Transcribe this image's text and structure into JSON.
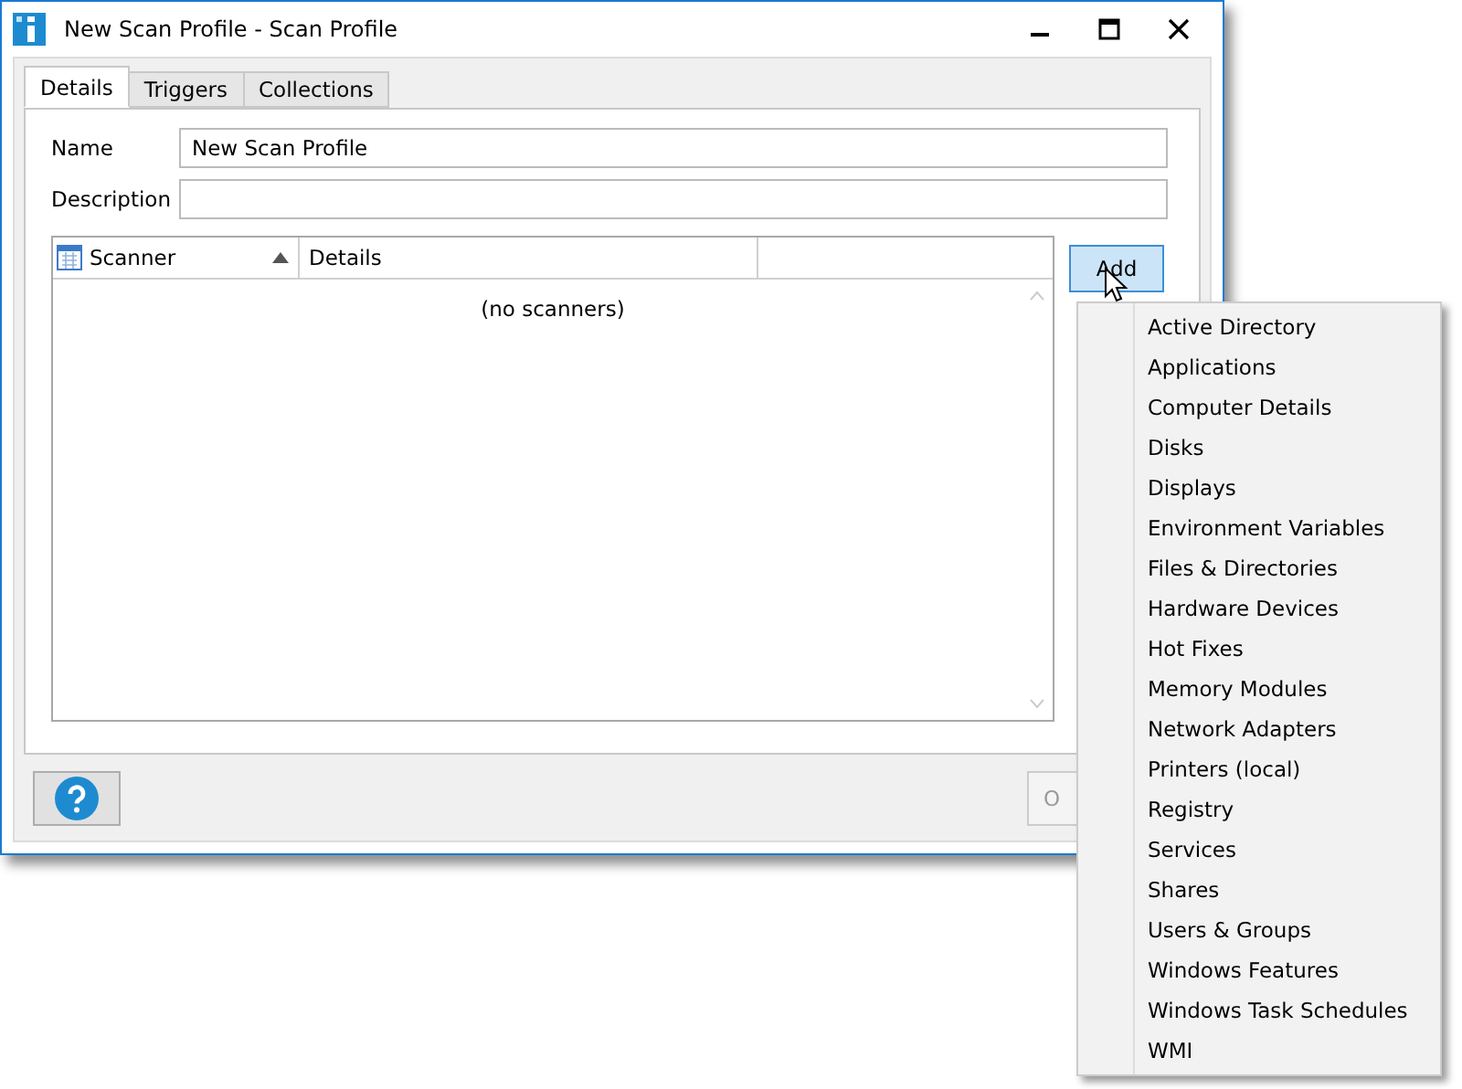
{
  "window": {
    "title": "New Scan Profile - Scan Profile"
  },
  "tabs": [
    {
      "label": "Details",
      "selected": true
    },
    {
      "label": "Triggers",
      "selected": false
    },
    {
      "label": "Collections",
      "selected": false
    }
  ],
  "fields": [
    {
      "label": "Name",
      "value": "New Scan Profile"
    },
    {
      "label": "Description"
    }
  ],
  "table": {
    "columns": [
      {
        "label": "Scanner",
        "sorted": true
      },
      {
        "label": "Details",
        "sorted": false
      },
      {}
    ],
    "empty_text": "(no scanners)"
  },
  "add_button": "Add",
  "ok_button": "O",
  "menu": [
    "Active Directory",
    "Applications",
    "Computer Details",
    "Disks",
    "Displays",
    "Environment Variables",
    "Files & Directories",
    "Hardware Devices",
    "Hot Fixes",
    "Memory Modules",
    "Network Adapters",
    "Printers (local)",
    "Registry",
    "Services",
    "Shares",
    "Users & Groups",
    "Windows Features",
    "Windows Task Schedules",
    "WMI"
  ]
}
